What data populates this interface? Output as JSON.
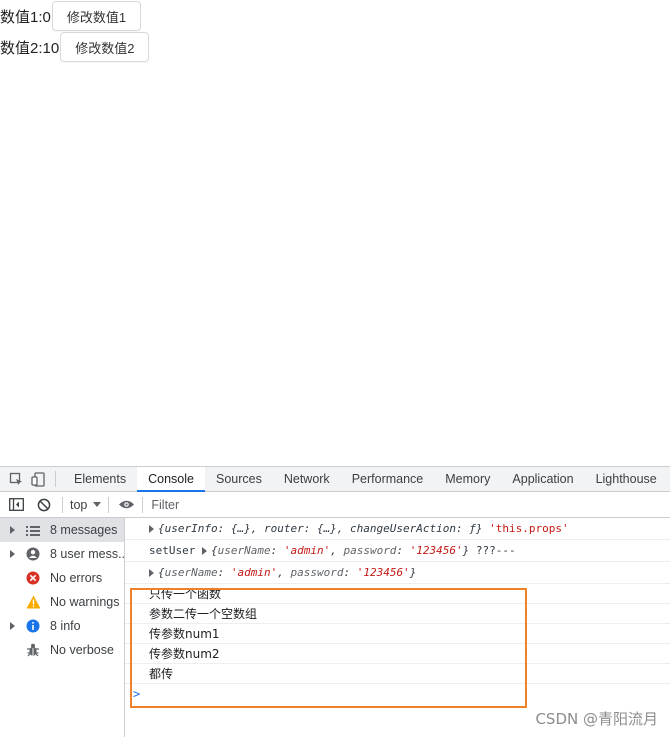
{
  "page": {
    "value1_label": "数值1:0",
    "value1_button": "修改数值1",
    "value2_label": "数值2:10",
    "value2_button": "修改数值2"
  },
  "devtools": {
    "tabs": [
      "Elements",
      "Console",
      "Sources",
      "Network",
      "Performance",
      "Memory",
      "Application",
      "Lighthouse"
    ],
    "active_tab": "Console",
    "context": "top",
    "filter_placeholder": "Filter",
    "sidebar": [
      {
        "label": "8 messages",
        "icon": "list-icon",
        "selected": true,
        "expandable": true
      },
      {
        "label": "8 user mess...",
        "icon": "user-icon",
        "selected": false,
        "expandable": true
      },
      {
        "label": "No errors",
        "icon": "error-icon",
        "selected": false,
        "expandable": false
      },
      {
        "label": "No warnings",
        "icon": "warning-icon",
        "selected": false,
        "expandable": false
      },
      {
        "label": "8 info",
        "icon": "info-icon",
        "selected": false,
        "expandable": true
      },
      {
        "label": "No verbose",
        "icon": "bug-icon",
        "selected": false,
        "expandable": false
      }
    ],
    "console_messages": {
      "m1": {
        "obj": "{userInfo: {…}, router: {…}, changeUserAction: ƒ}",
        "str": "'this.props'"
      },
      "m2": {
        "prefix": "setUser",
        "k1": "userName",
        "v1": "'admin'",
        "k2": "password",
        "v2": "'123456'",
        "suffix": "???---"
      },
      "m3": {
        "k1": "userName",
        "v1": "'admin'",
        "k2": "password",
        "v2": "'123456'"
      },
      "m4": "只传一个函数",
      "m5": "参数二传一个空数组",
      "m6": "传参数num1",
      "m7": "传参数num2",
      "m8": "都传"
    },
    "prompt": ">"
  },
  "colors": {
    "highlight_border": "#ee822a",
    "active_tab_underline": "#1a73e8",
    "string_red": "#c41a16"
  },
  "watermark": "CSDN @青阳流月"
}
